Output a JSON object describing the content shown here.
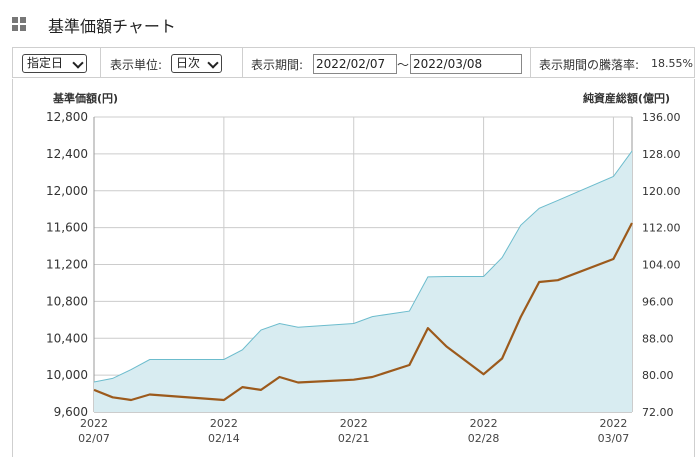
{
  "header": {
    "title": "基準価額チャート",
    "icon": "grid-icon"
  },
  "toolbar": {
    "range_type": "指定日",
    "unit_label": "表示単位:",
    "unit_value": "日次",
    "period_label": "表示期間:",
    "start_date": "2022/02/07",
    "tilde": "～",
    "end_date": "2022/03/08",
    "change_label": "表示期間の騰落率:",
    "change_value": "18.55%"
  },
  "colors": {
    "nav_line": "#9c5a1c",
    "area_fill": "#d8ecf1",
    "area_line": "#6cbccd",
    "grid": "#cccccc"
  },
  "chart_data": {
    "type": "line",
    "ylabel": "基準価額(円)",
    "y2label": "純資産総額(億円)",
    "ylim": [
      9600,
      12800
    ],
    "y2lim": [
      72,
      136
    ],
    "y_ticks": [
      "12,800",
      "12,400",
      "12,000",
      "11,600",
      "11,200",
      "10,800",
      "10,400",
      "10,000",
      "9,600"
    ],
    "y2_ticks": [
      "136.00",
      "128.00",
      "120.00",
      "112.00",
      "104.00",
      "96.00",
      "88.00",
      "80.00",
      "72.00"
    ],
    "x_ticks": [
      {
        "year": "2022",
        "date": "02/07"
      },
      {
        "year": "2022",
        "date": "02/14"
      },
      {
        "year": "2022",
        "date": "02/21"
      },
      {
        "year": "2022",
        "date": "02/28"
      },
      {
        "year": "2022",
        "date": "03/07"
      }
    ],
    "x_tick_index": [
      0,
      7,
      14,
      21,
      28
    ],
    "x_max": 29,
    "series": [
      {
        "axis": "left",
        "type": "line",
        "x": [
          0,
          1,
          2,
          3,
          7,
          8,
          9,
          10,
          11,
          14,
          15,
          17,
          18,
          19,
          21,
          22,
          23,
          24,
          25,
          28,
          29
        ],
        "values": [
          9840,
          9760,
          9730,
          9790,
          9730,
          9870,
          9840,
          9980,
          9920,
          9950,
          9980,
          10110,
          10510,
          10310,
          10010,
          10180,
          10630,
          11010,
          11030,
          11260,
          11650
        ]
      },
      {
        "axis": "right",
        "type": "area",
        "x": [
          0,
          1,
          2,
          3,
          7,
          8,
          9,
          10,
          11,
          14,
          15,
          17,
          18,
          19,
          21,
          22,
          23,
          24,
          25,
          28,
          29
        ],
        "values": [
          78.5,
          79.3,
          81.2,
          83.4,
          83.4,
          85.5,
          89.8,
          91.2,
          90.4,
          91.2,
          92.7,
          93.9,
          101.3,
          101.4,
          101.4,
          105.5,
          112.5,
          116.2,
          117.9,
          123.1,
          128.6
        ]
      }
    ]
  }
}
